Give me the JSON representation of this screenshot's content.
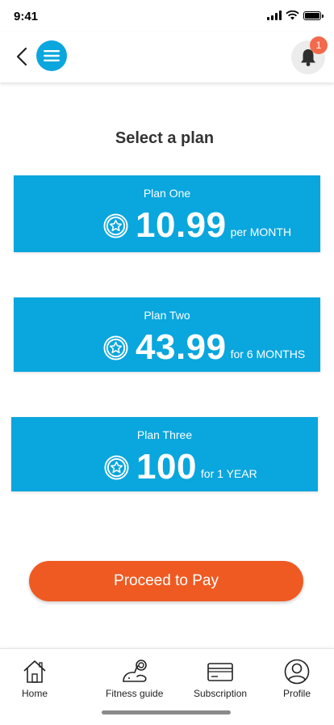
{
  "status_bar": {
    "time": "9:41"
  },
  "header": {
    "notification_count": "1"
  },
  "page": {
    "title": "Select a plan"
  },
  "plans": [
    {
      "name": "Plan One",
      "price": "10.99",
      "period": "per MONTH"
    },
    {
      "name": "Plan Two",
      "price": "43.99",
      "period": "for 6 MONTHS"
    },
    {
      "name": "Plan Three",
      "price": "100",
      "period": "for 1 YEAR"
    }
  ],
  "actions": {
    "proceed_label": "Proceed to Pay"
  },
  "bottom_nav": {
    "items": [
      {
        "label": "Home",
        "icon": "home-icon"
      },
      {
        "label": "Fitness guide",
        "icon": "fitness-icon"
      },
      {
        "label": "Subscription",
        "icon": "card-icon"
      },
      {
        "label": "Profile",
        "icon": "profile-icon"
      }
    ]
  },
  "colors": {
    "primary": "#0aa6de",
    "accent": "#ef5a22",
    "badge": "#f26a4b"
  }
}
